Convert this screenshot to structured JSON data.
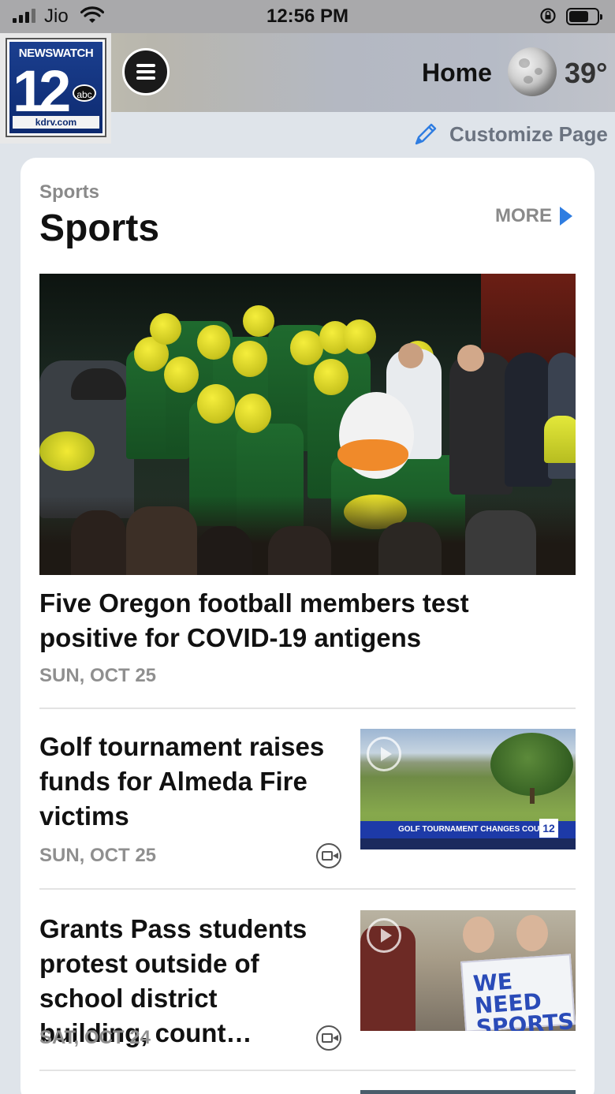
{
  "status_bar": {
    "carrier": "Jio",
    "time": "12:56 PM"
  },
  "header": {
    "logo": {
      "top_text": "NEWSWATCH",
      "number": "12",
      "network": "abc",
      "domain": "kdrv.com"
    },
    "home_label": "Home",
    "temperature": "39°",
    "weather_icon": "moon-icon"
  },
  "customize": {
    "label": "Customize Page"
  },
  "section": {
    "kicker": "Sports",
    "title": "Sports",
    "more_label": "MORE",
    "accent_color": "#2f7de1"
  },
  "stories": [
    {
      "headline": "Five Oregon football members test positive for COVID-19 antigens",
      "date": "SUN, OCT 25"
    },
    {
      "headline": "Golf tournament raises funds for Almeda Fire victims",
      "date": "SUN, OCT 25",
      "has_video": true,
      "thumb_banner": "GOLF TOURNAMENT CHANGES COURSE"
    },
    {
      "headline": "Grants Pass students protest outside of school district building, count…",
      "date": "SAT, OCT 24",
      "has_video": true,
      "thumb_sign": "WE NEED SPORTS"
    }
  ]
}
